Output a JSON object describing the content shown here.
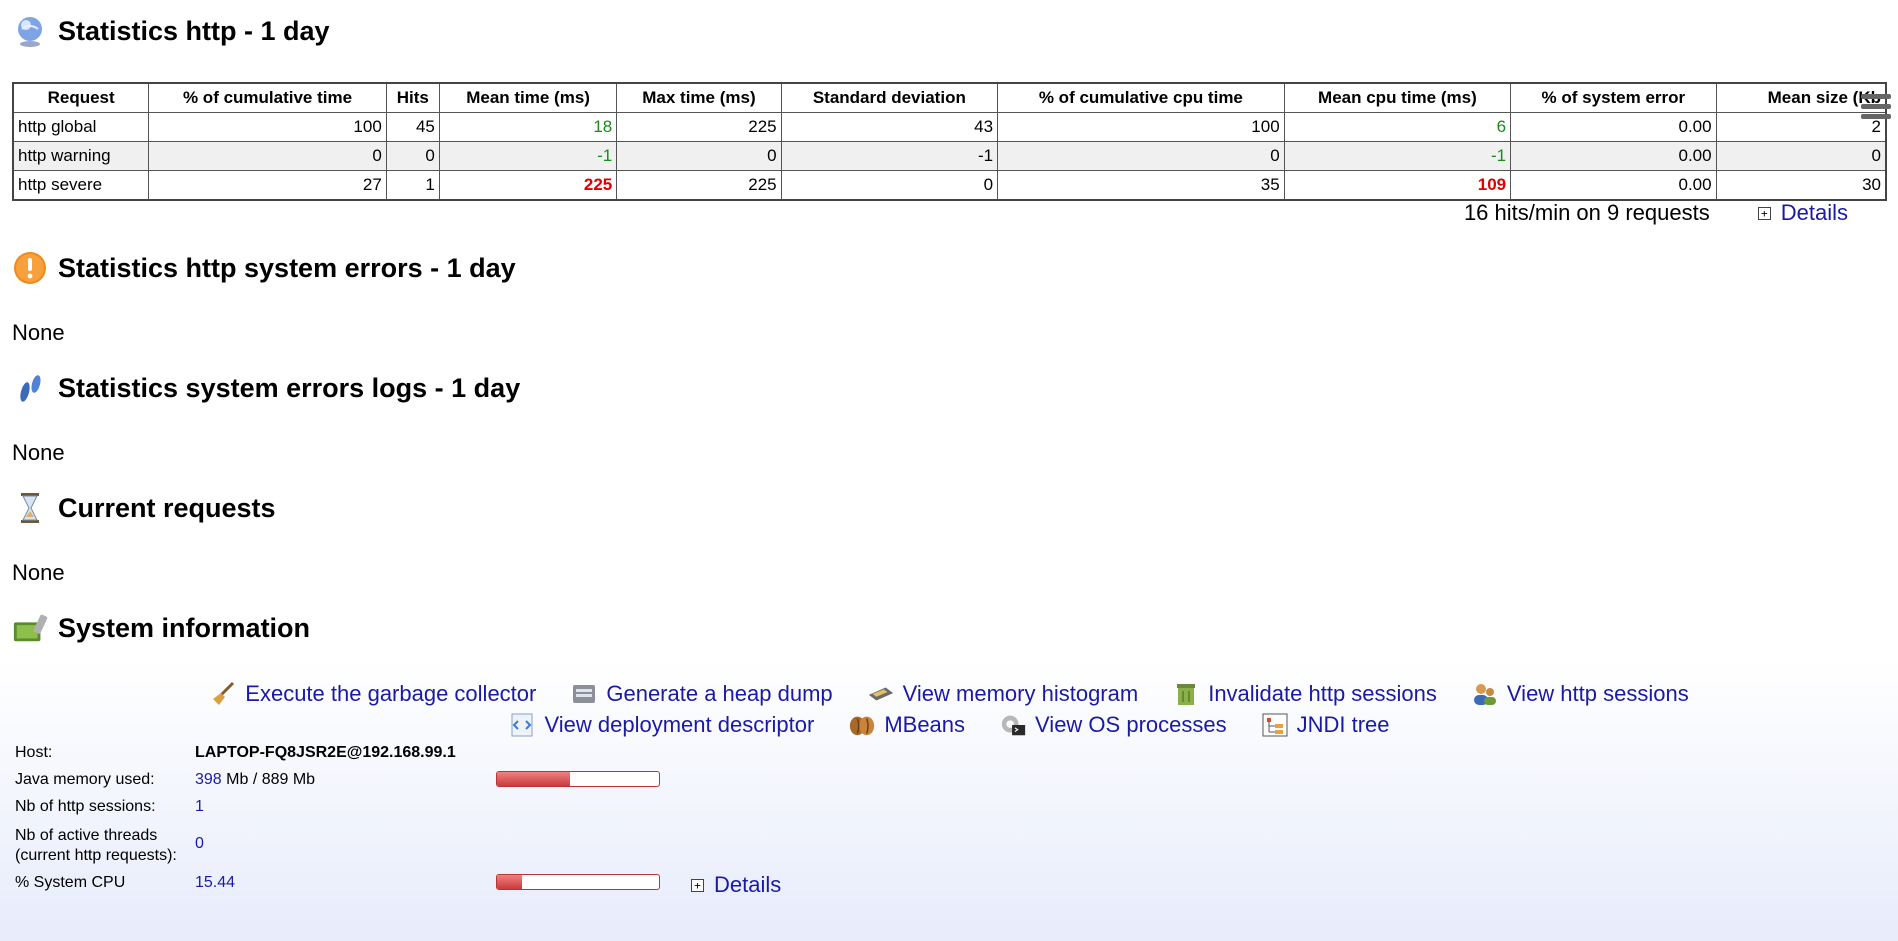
{
  "sections": {
    "http_stats_title": "Statistics http - 1 day",
    "system_errors_title": "Statistics http system errors - 1 day",
    "system_errors_value": "None",
    "error_logs_title": "Statistics system errors logs - 1 day",
    "error_logs_value": "None",
    "current_requests_title": "Current requests",
    "current_requests_value": "None",
    "system_info_title": "System information"
  },
  "table": {
    "headers": [
      "Request",
      "% of cumulative time",
      "Hits",
      "Mean time (ms)",
      "Max time (ms)",
      "Standard deviation",
      "% of cumulative cpu time",
      "Mean cpu time (ms)",
      "% of system error",
      "Mean size (Kb"
    ],
    "rows": [
      {
        "cells": [
          "http global",
          "100",
          "45",
          "18",
          "225",
          "43",
          "100",
          "6",
          "0.00",
          "2"
        ]
      },
      {
        "cells": [
          "http warning",
          "0",
          "0",
          "-1",
          "0",
          "-1",
          "0",
          "-1",
          "0.00",
          "0"
        ]
      },
      {
        "cells": [
          "http severe",
          "27",
          "1",
          "225",
          "225",
          "0",
          "35",
          "109",
          "0.00",
          "30"
        ]
      }
    ]
  },
  "summary": {
    "text": "16 hits/min on 9 requests",
    "details_label": "Details"
  },
  "actions": {
    "row1": [
      {
        "label": "Execute the garbage collector",
        "icon": "broom-icon"
      },
      {
        "label": "Generate a heap dump",
        "icon": "heap-dump-icon"
      },
      {
        "label": "View memory histogram",
        "icon": "memory-histogram-icon"
      },
      {
        "label": "Invalidate http sessions",
        "icon": "trash-icon"
      },
      {
        "label": "View http sessions",
        "icon": "users-icon"
      }
    ],
    "row2": [
      {
        "label": "View deployment descriptor",
        "icon": "xml-icon"
      },
      {
        "label": "MBeans",
        "icon": "beans-icon"
      },
      {
        "label": "View OS processes",
        "icon": "processes-icon"
      },
      {
        "label": "JNDI tree",
        "icon": "tree-icon"
      }
    ]
  },
  "system": {
    "host_label": "Host:",
    "host_value": "LAPTOP-FQ8JSR2E@192.168.99.1",
    "memory_label": "Java memory used:",
    "memory_used": "398",
    "memory_rest": " Mb / 889 Mb",
    "memory_fraction": 0.448,
    "sessions_label": "Nb of http sessions:",
    "sessions_value": "1",
    "threads_label_1": "Nb of active threads",
    "threads_label_2": "(current http requests):",
    "threads_value": "0",
    "cpu_label": "% System CPU",
    "cpu_value": "15.44",
    "cpu_fraction": 0.1544,
    "details_label": "Details"
  },
  "colors": {
    "link": "#1a1aa6",
    "good": "#1a8a1a",
    "bad": "#e00000"
  }
}
